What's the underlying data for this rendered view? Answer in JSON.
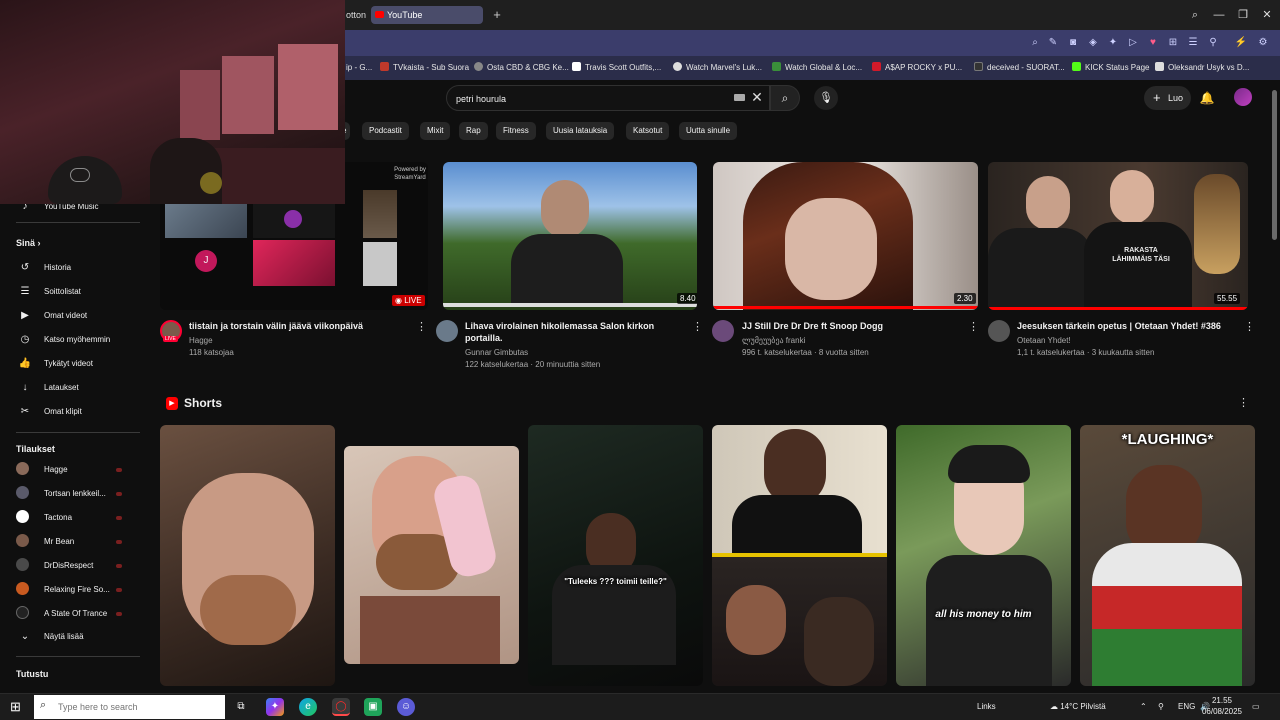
{
  "browser": {
    "tab_partial": "otton",
    "active_tab": "YouTube",
    "new_tab_glyph": "+",
    "bookmarks": [
      {
        "label": "ip - G...",
        "color": "#2e7dd7"
      },
      {
        "label": "TVkaista - Sub Suora",
        "color": "#c0392b"
      },
      {
        "label": "Osta CBD & CBG Ke...",
        "color": "#888888"
      },
      {
        "label": "Travis Scott Outfits,...",
        "color": "#ffffff"
      },
      {
        "label": "Watch Marvel's Luk...",
        "color": "#dddddd"
      },
      {
        "label": "Watch Global & Loc...",
        "color": "#3a8f3a"
      },
      {
        "label": "A$AP ROCKY x PU...",
        "color": "#d11a2a"
      },
      {
        "label": "deceived - SUORAT...",
        "color": "#333333"
      },
      {
        "label": "KICK Status Page",
        "color": "#53fc18"
      },
      {
        "label": "Oleksandr Usyk vs D...",
        "color": "#dddddd"
      }
    ]
  },
  "header": {
    "search_value": "petri hourula",
    "create_label": "Luo"
  },
  "chips": [
    "e",
    "Podcastit",
    "Mixit",
    "Rap",
    "Fitness",
    "Uusia latauksia",
    "Katsotut",
    "Uutta sinulle"
  ],
  "sidebar": {
    "partial_item": "YouTube Music",
    "you_heading": "Sinä",
    "you_chevron": "›",
    "items": [
      {
        "label": "Historia",
        "icon": "↺"
      },
      {
        "label": "Soittolistat",
        "icon": "☰"
      },
      {
        "label": "Omat videot",
        "icon": "▶"
      },
      {
        "label": "Katso myöhemmin",
        "icon": "◷"
      },
      {
        "label": "Tykätyt videot",
        "icon": "👍"
      },
      {
        "label": "Lataukset",
        "icon": "↓"
      },
      {
        "label": "Omat klipit",
        "icon": "✂"
      }
    ],
    "subs_heading": "Tilaukset",
    "subscriptions": [
      {
        "label": "Hagge",
        "color": "#8a6a5a"
      },
      {
        "label": "Tortsan lenkkeil...",
        "color": "#5a5a6a"
      },
      {
        "label": "Tactona",
        "color": "#ffffff"
      },
      {
        "label": "Mr Bean",
        "color": "#7a5a4a"
      },
      {
        "label": "DrDisRespect",
        "color": "#4a4a4a"
      },
      {
        "label": "Relaxing Fire So...",
        "color": "#c85a20"
      },
      {
        "label": "A State Of Trance",
        "color": "#222222"
      }
    ],
    "show_more": "Näytä lisää",
    "show_more_icon": "⌄",
    "explore_heading": "Tutustu"
  },
  "videos": [
    {
      "title": "tiistain ja torstain välin jäävä viikonpäivä",
      "channel": "Hagge",
      "meta": "118 katsojaa",
      "badge": "LIVE",
      "overlay_caption": "Powered by StreamYard",
      "avatar_letter": "J",
      "avatar_live": "LIVE"
    },
    {
      "title": "Lihava virolainen hikoilemassa Salon kirkon portailla.",
      "channel": "Gunnar Gimbutas",
      "meta": "122 katselukertaa · 20 minuuttia sitten",
      "duration": "8.40"
    },
    {
      "title": "JJ  Still Dre Dr Dre ft  Snoop Dogg",
      "channel": "ლუმეუუბეა franki",
      "meta": "996 t. katselukertaa · 8 vuotta sitten",
      "duration": "2.30"
    },
    {
      "title": "Jeesuksen tärkein opetus | Otetaan Yhdet! #386",
      "channel": "Otetaan Yhdet!",
      "meta": "1,1 t. katselukertaa · 3 kuukautta sitten",
      "duration": "55.55",
      "shirt_text": "RAKASTA LÄHIMMÄIS TÄSI"
    }
  ],
  "shorts": {
    "heading": "Shorts",
    "items": [
      {
        "caption": ""
      },
      {
        "caption": ""
      },
      {
        "caption": "\"Tuleeks ??? toimii teille?\""
      },
      {
        "caption": ""
      },
      {
        "caption": "all his money to him"
      },
      {
        "caption": "*LAUGHING*"
      }
    ]
  },
  "taskbar": {
    "search_placeholder": "Type here to search",
    "links_label": "Links",
    "weather": "14°C  Pilvistä",
    "lang": "ENG",
    "time": "21.55",
    "date": "06/08/2025"
  },
  "colors": {
    "bg": "#0f0f0f",
    "accent_red": "#ff0000",
    "address_bar": "#3b3d6b"
  }
}
